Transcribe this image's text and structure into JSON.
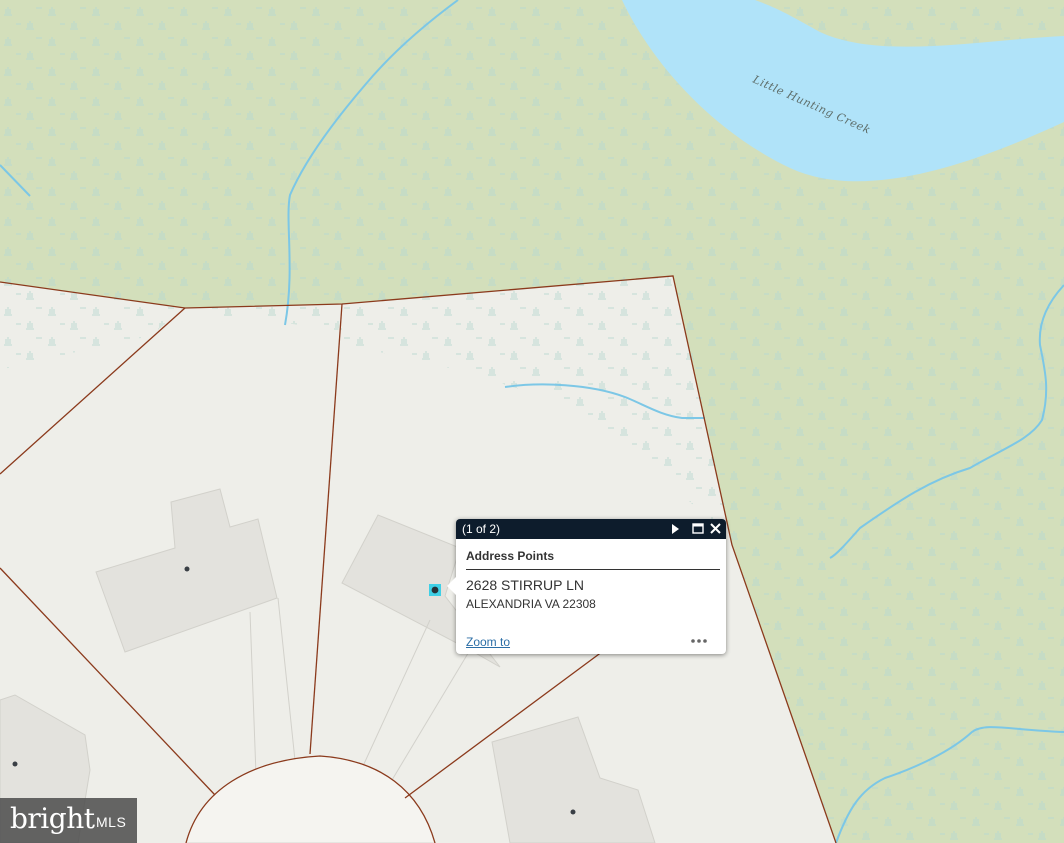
{
  "map": {
    "water_label": "Little Hunting Creek",
    "colors": {
      "wetland": "#d3dfbb",
      "parcel": "#eeeee9",
      "water": "#b0e3f9",
      "stream": "#7cc7e6",
      "parcel_line": "#8b3a1c",
      "building": "#e3e2dd"
    }
  },
  "popup": {
    "count": "(1 of 2)",
    "title": "Address Points",
    "address_line1": "2628 STIRRUP LN",
    "address_line2": "ALEXANDRIA VA 22308",
    "zoom_link": "Zoom to",
    "next_icon": "play-icon",
    "maximize_icon": "maximize-icon",
    "close_icon": "close-icon",
    "more_icon": "more-icon"
  },
  "watermark": {
    "brand": "bright",
    "sub": "MLS"
  }
}
